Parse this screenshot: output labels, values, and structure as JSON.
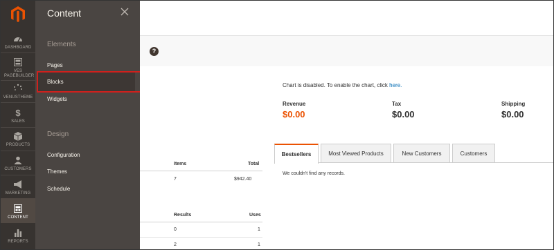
{
  "rail": {
    "items": [
      {
        "label": "DASHBOARD",
        "icon": "dashboard-icon"
      },
      {
        "label": "VES PAGEBUILDER",
        "icon": "pagebuilder-icon"
      },
      {
        "label": "VENUSTHEME",
        "icon": "venustheme-icon"
      },
      {
        "label": "SALES",
        "icon": "dollar-icon"
      },
      {
        "label": "PRODUCTS",
        "icon": "cube-icon"
      },
      {
        "label": "CUSTOMERS",
        "icon": "customers-icon"
      },
      {
        "label": "MARKETING",
        "icon": "megaphone-icon"
      },
      {
        "label": "CONTENT",
        "icon": "content-icon"
      },
      {
        "label": "REPORTS",
        "icon": "bar-chart-icon"
      }
    ]
  },
  "flyout": {
    "title": "Content",
    "elements_heading": "Elements",
    "elements": [
      "Pages",
      "Blocks",
      "Widgets"
    ],
    "design_heading": "Design",
    "design": [
      "Configuration",
      "Themes",
      "Schedule"
    ]
  },
  "dashboard": {
    "help": "?",
    "chart_msg": "Chart is disabled. To enable the chart, click ",
    "chart_link": "here.",
    "stats": [
      {
        "label": "Revenue",
        "value": "$0.00"
      },
      {
        "label": "Tax",
        "value": "$0.00"
      },
      {
        "label": "Shipping",
        "value": "$0.00"
      }
    ],
    "tabs": [
      "Bestsellers",
      "Most Viewed Products",
      "New Customers",
      "Customers"
    ],
    "no_records": "We couldn't find any records.",
    "orders_table": {
      "headers": [
        "Items",
        "Total"
      ],
      "row": [
        "7",
        "$942.40"
      ]
    },
    "search_table": {
      "headers": [
        "Results",
        "Uses"
      ],
      "rows": [
        [
          "0",
          "1"
        ],
        [
          "2",
          "1"
        ]
      ]
    }
  },
  "colors": {
    "accent": "#eb5202",
    "rail": "#373330",
    "flyout": "#4a4542",
    "highlight": "#d0201c",
    "link": "#006bb4"
  }
}
